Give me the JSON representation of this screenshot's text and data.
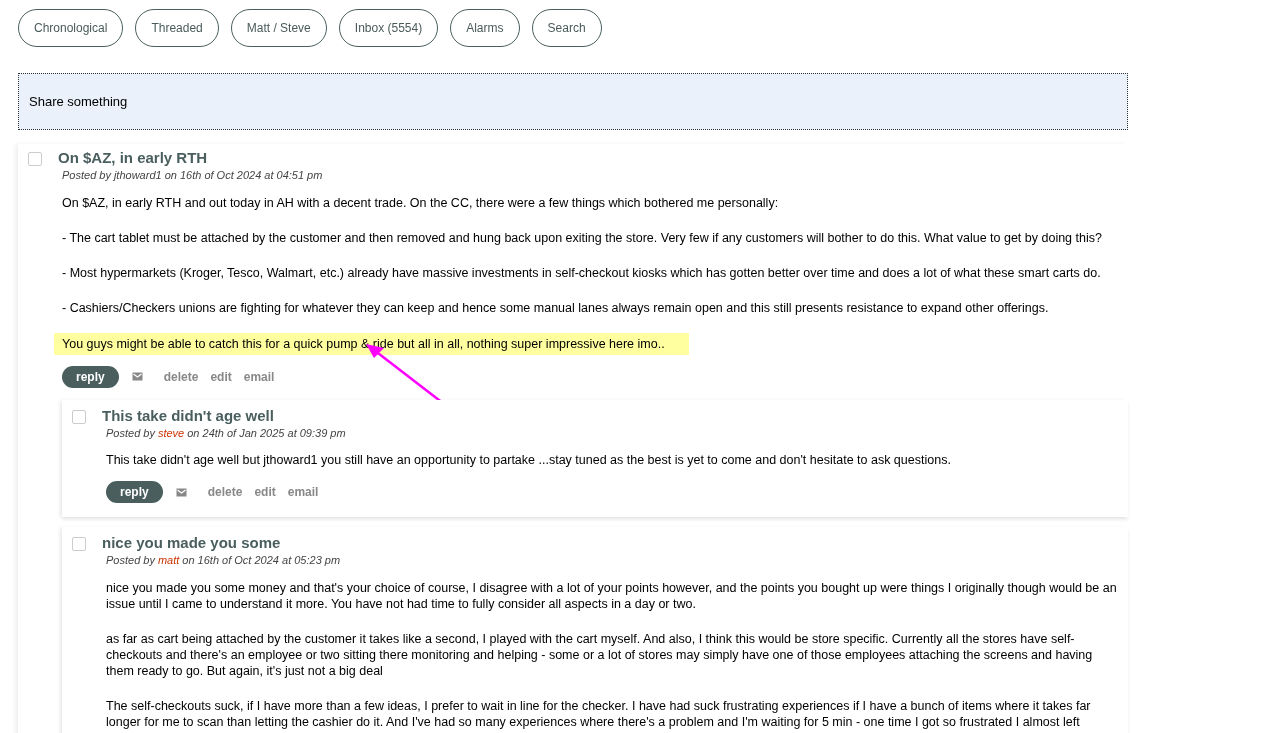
{
  "tabs": [
    {
      "label": "Chronological",
      "selected": false
    },
    {
      "label": "Threaded",
      "selected": false
    },
    {
      "label": "Matt / Steve",
      "selected": false
    },
    {
      "label": "Inbox (5554)",
      "selected": false
    },
    {
      "label": "Alarms",
      "selected": false
    },
    {
      "label": "Search",
      "selected": false
    }
  ],
  "share_box": {
    "placeholder": "Share something"
  },
  "posts": [
    {
      "checked": false,
      "title": "On $AZ, in early RTH",
      "posted_by": "Posted by",
      "author": "jthoward1",
      "author_highlighted": false,
      "date": "on 16th of Oct 2024 at 04:51 pm",
      "paragraphs": [
        {
          "text": "On $AZ, in early RTH and out today in AH with a decent trade. On the CC, there were a few things which bothered me personally:",
          "highlighted": false
        },
        {
          "text": "- The cart tablet must be attached by the customer and then removed and hung back upon exiting the store. Very few if any customers will bother to do this. What value to get by doing this?",
          "highlighted": false
        },
        {
          "text": "- Most hypermarkets (Kroger, Tesco, Walmart, etc.) already have massive investments in self-checkout kiosks which has gotten better over time and does a lot of what these smart carts do.",
          "highlighted": false
        },
        {
          "text": "- Cashiers/Checkers unions are fighting for whatever they can keep and hence some manual lanes always remain open and this still presents resistance to expand other offerings.",
          "highlighted": false
        },
        {
          "text": "You guys might be able to catch this for a quick pump & ride but all in all, nothing super impressive here imo..",
          "highlighted": true,
          "annotated": true
        }
      ],
      "actions": {
        "reply": "reply",
        "links": [
          "delete",
          "edit",
          "email"
        ]
      },
      "children": [
        {
          "checked": false,
          "title": "This take didn't age well",
          "posted_by": "Posted by",
          "author": "steve",
          "author_highlighted": true,
          "date": "on 24th of Jan 2025 at 09:39 pm",
          "paragraphs": [
            {
              "text": "This take didn't age well but jthoward1 you still have an opportunity to partake ...stay tuned as the best is yet to come and don't hesitate to ask questions.",
              "highlighted": false
            }
          ],
          "actions": {
            "reply": "reply",
            "links": [
              "delete",
              "edit",
              "email"
            ]
          }
        },
        {
          "checked": false,
          "title": "nice you made you some",
          "posted_by": "Posted by",
          "author": "matt",
          "author_highlighted": true,
          "date": "on 16th of Oct 2024 at 05:23 pm",
          "paragraphs": [
            {
              "text": "nice you made you some money and that's your choice of course, I disagree with a lot of your points however, and the points you bought up were things I originally though would be an issue until I came to understand it more. You have not had time to fully consider all aspects in a day or two.",
              "highlighted": false
            },
            {
              "text": "as far as cart being attached by the customer it takes like a second, I played with the cart myself. And also, I think this would be store specific. Currently all the stores have self-checkouts and there's an employee or two sitting there monitoring and helping - some or a lot of stores may simply have one of those employees attaching the screens and having them ready to go. But again, it's just not a big deal",
              "highlighted": false
            },
            {
              "text": "The self-checkouts suck, if I have more than a few ideas, I prefer to wait in line for the checker. I have had suck frustrating experiences if I have a bunch of items where it takes far longer for me to scan than letting the cashier do it.  And I've had so many experiences where there's a problem and I'm waiting for 5 min - one time I got so frustrated I almost left",
              "highlighted": false
            }
          ]
        }
      ]
    }
  ]
}
